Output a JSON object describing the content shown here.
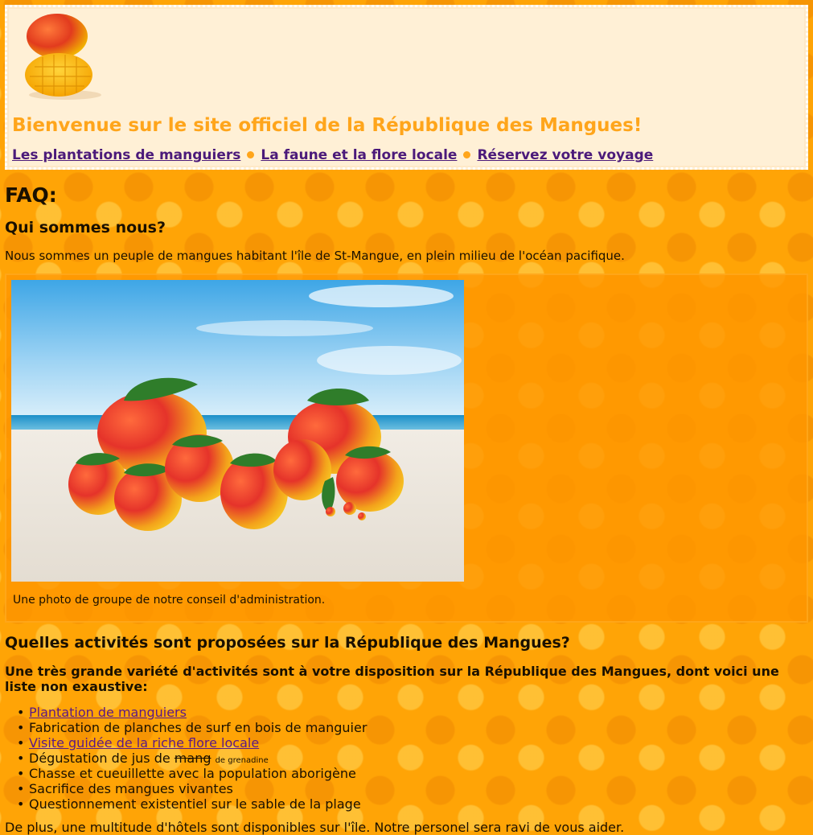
{
  "header": {
    "title": "Bienvenue sur le site officiel de la République des Mangues!",
    "nav": [
      {
        "label": "Les plantations de manguiers"
      },
      {
        "label": "La faune et la flore locale"
      },
      {
        "label": "Réservez votre voyage"
      }
    ]
  },
  "faq": {
    "title": "FAQ:",
    "q1": {
      "question": "Qui sommes nous?",
      "answer": "Nous sommes un peuple de mangues habitant l'île de St-Mangue, en plein milieu de l'océan pacifique.",
      "caption": "Une photo de groupe de notre conseil d'administration."
    },
    "q2": {
      "question": "Quelles activités sont proposées sur la République des Mangues?",
      "intro": "Une très grande variété d'activités sont à votre disposition sur la République des Mangues, dont voici une liste non exaustive:",
      "activities": [
        {
          "text": "Plantation de manguiers"
        },
        {
          "text": "Fabrication de planches de surf en bois de manguier"
        },
        {
          "text": "Visite guidée de la riche flore locale"
        },
        {
          "text": "Dégustation de jus de ",
          "struck": "mang",
          "small": "de grenadine"
        },
        {
          "text": "Chasse et cueuillette avec la population aborigène"
        },
        {
          "text": "Sacrifice des mangues vivantes"
        },
        {
          "text": "Questionnement existentiel sur le sable de la plage"
        }
      ],
      "outro": "De plus, une multitude d'hôtels sont disponibles sur l'île. Notre personel sera ravi de vous aider."
    }
  },
  "colors": {
    "background": "#ffa406",
    "title": "#ffa51b",
    "link": "#4b1a7a",
    "header_bg": "#fff0d6"
  }
}
